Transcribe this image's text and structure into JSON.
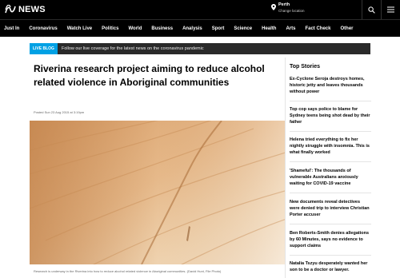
{
  "header": {
    "logo_text": "NEWS",
    "location_city": "Perth",
    "location_change": "Change location",
    "search_icon": "search-icon",
    "menu_icon": "menu-icon"
  },
  "nav": {
    "items": [
      "Just In",
      "Coronavirus",
      "Watch Live",
      "Politics",
      "World",
      "Business",
      "Analysis",
      "Sport",
      "Science",
      "Health",
      "Arts",
      "Fact Check",
      "Other"
    ]
  },
  "live_banner": {
    "badge": "LIVE BLOG",
    "text": "Follow our live coverage for the latest news on the coronavirus pandemic"
  },
  "article": {
    "headline": "Riverina research project aiming to reduce alcohol related violence in Aboriginal communities",
    "posted": "Posted Sun 23 Aug 2015 at 3:19pm",
    "caption": "Research is underway in the Riverina into how to reduce alcohol related violence in Aboriginal communities. (David Hunt, File Photo)"
  },
  "sidebar": {
    "title": "Top Stories",
    "stories": [
      "Ex-Cyclone Seroja destroys homes, historic jetty and leaves thousands without power",
      "Top cop says police to blame for Sydney teens being shot dead by their father",
      "Helena tried everything to fix her nightly struggle with insomnia. This is what finally worked",
      "'Shameful': The thousands of vulnerable Australians anxiously waiting for COVID-19 vaccine",
      "New documents reveal detectives were denied trip to interview Christian Porter accuser",
      "Ben Roberts-Smith denies allegations by 60 Minutes, says no evidence to support claims",
      "Natalia Tszyu desperately wanted her son to be a doctor or lawyer."
    ]
  },
  "colors": {
    "topbar": "#000000",
    "live_badge": "#00a1e4",
    "banner_bg": "#2a2a2a"
  }
}
